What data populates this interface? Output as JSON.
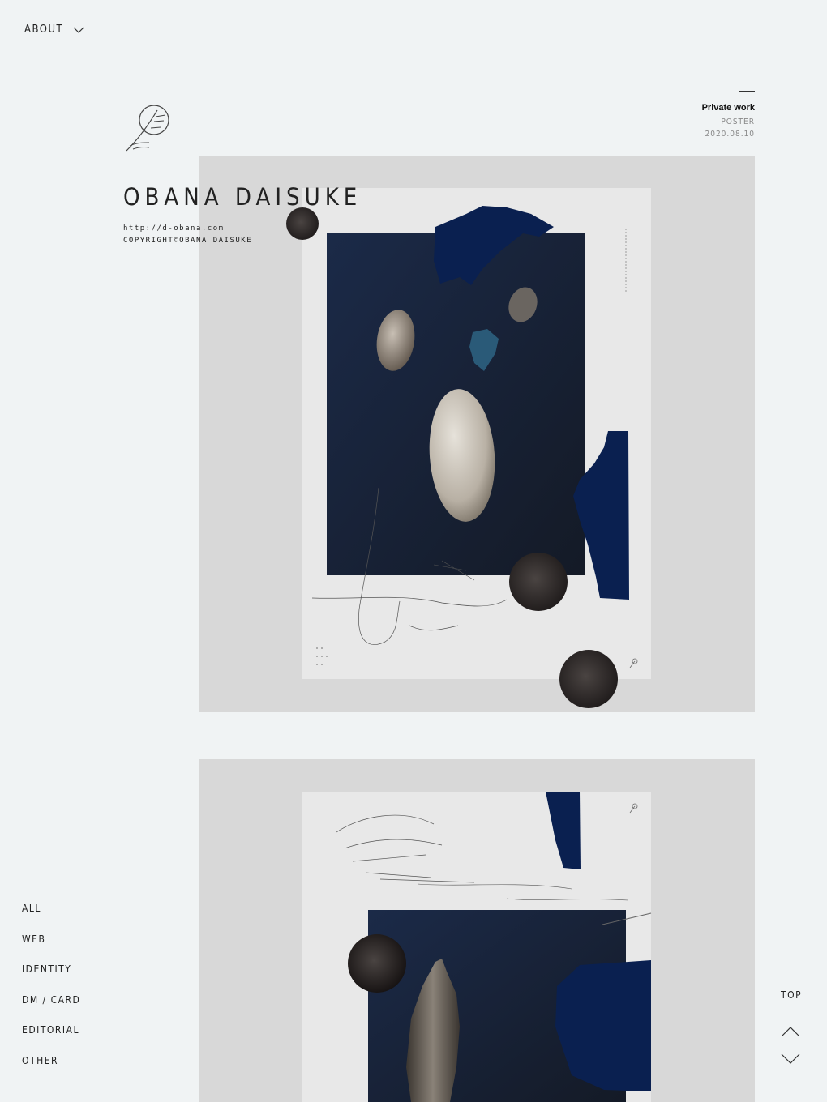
{
  "header": {
    "about_label": "ABOUT"
  },
  "brand": {
    "name": "OBANA DAISUKE",
    "url": "http://d-obana.com",
    "copyright": "COPYRIGHT©OBANA DAISUKE"
  },
  "work": {
    "title": "Private work",
    "category": "POSTER",
    "date": "2020.08.10"
  },
  "nav": {
    "items": [
      "ALL",
      "WEB",
      "IDENTITY",
      "DM / CARD",
      "EDITORIAL",
      "OTHER"
    ]
  },
  "scroll": {
    "top_label": "TOP"
  },
  "colors": {
    "background": "#f0f3f4",
    "card": "#d8d8d8",
    "poster": "#e8e8e8",
    "navy": "#0a2050",
    "dark_photo": "#1a2436"
  }
}
